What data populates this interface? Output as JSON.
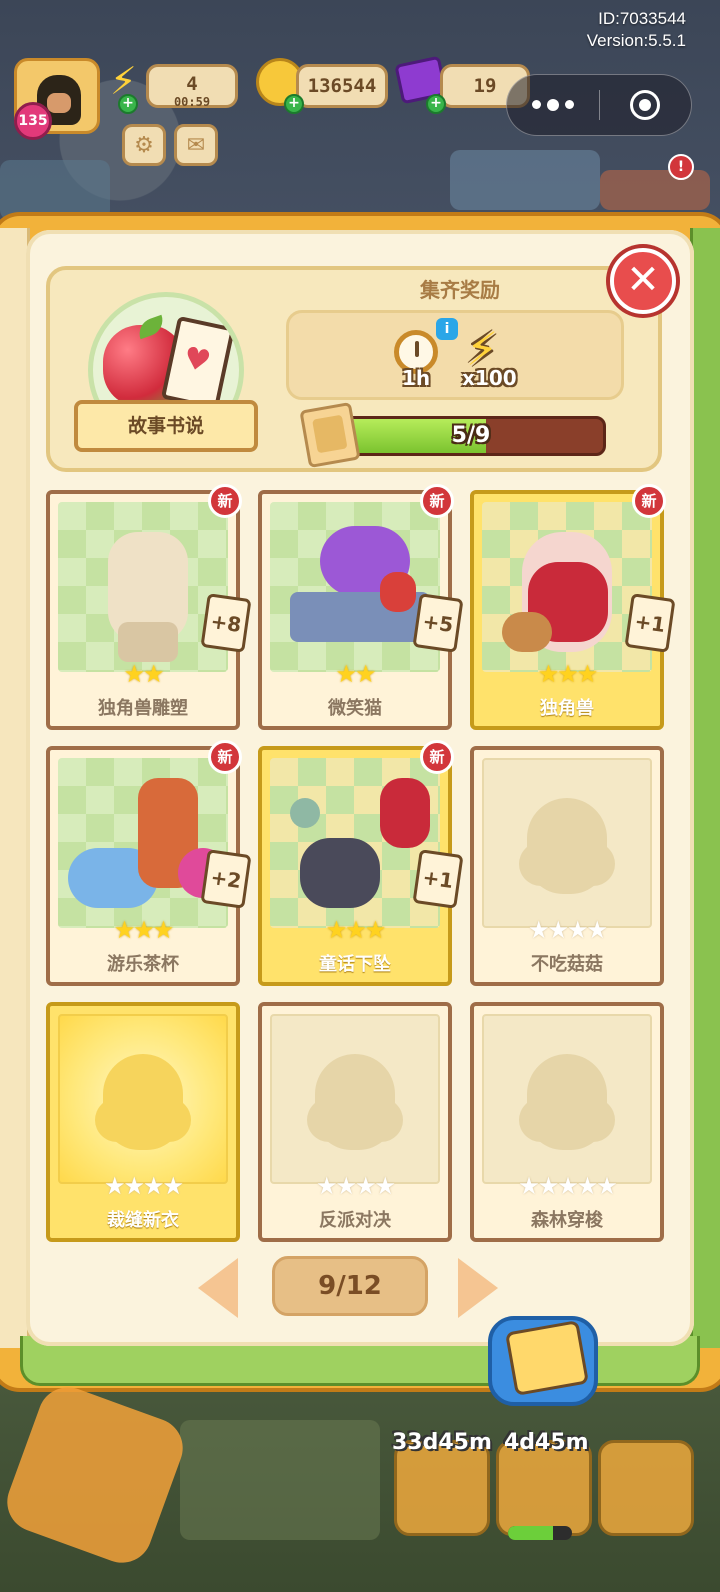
{
  "app": {
    "id_text": "ID:7033544",
    "version_text": "Version:5.5.1"
  },
  "hud": {
    "level": "135",
    "energy": {
      "value": "4",
      "timer": "00:59",
      "icon": "energy-bolt-icon"
    },
    "coins": {
      "value": "136544",
      "icon": "coin-icon"
    },
    "gems": {
      "value": "19",
      "icon": "gem-icon"
    },
    "buttons": [
      "settings-gear-icon",
      "mail-icon"
    ],
    "mini_program": {
      "more": "more-dots-icon",
      "close": "target-close-icon"
    }
  },
  "album": {
    "name": "故事书说",
    "reward_title": "集齐奖励",
    "rewards": [
      {
        "icon": "clock-icon",
        "value": "1h"
      },
      {
        "icon": "energy-bolt-icon",
        "value": "x100"
      }
    ],
    "progress": {
      "text": "5/9",
      "collected": 5,
      "total": 9
    },
    "close_icon": "close-icon"
  },
  "cards": [
    {
      "name": "独角兽雕塑",
      "stars_total": 2,
      "stars_filled": 2,
      "collected": true,
      "gold": false,
      "new_badge": "新",
      "duplicates": "+8"
    },
    {
      "name": "微笑猫",
      "stars_total": 2,
      "stars_filled": 2,
      "collected": true,
      "gold": false,
      "new_badge": "新",
      "duplicates": "+5"
    },
    {
      "name": "独角兽",
      "stars_total": 3,
      "stars_filled": 3,
      "collected": true,
      "gold": true,
      "new_badge": "新",
      "duplicates": "+1"
    },
    {
      "name": "游乐茶杯",
      "stars_total": 3,
      "stars_filled": 3,
      "collected": true,
      "gold": false,
      "new_badge": "新",
      "duplicates": "+2"
    },
    {
      "name": "童话下坠",
      "stars_total": 3,
      "stars_filled": 3,
      "collected": true,
      "gold": true,
      "new_badge": "新",
      "duplicates": "+1"
    },
    {
      "name": "不吃菇菇",
      "stars_total": 4,
      "stars_filled": 0,
      "collected": false,
      "gold": false
    },
    {
      "name": "裁缝新衣",
      "stars_total": 4,
      "stars_filled": 0,
      "collected": false,
      "gold": true
    },
    {
      "name": "反派对决",
      "stars_total": 4,
      "stars_filled": 0,
      "collected": false,
      "gold": false
    },
    {
      "name": "森林穿梭",
      "stars_total": 5,
      "stars_filled": 0,
      "collected": false,
      "gold": false
    }
  ],
  "pagination": {
    "text": "9/12",
    "prev_icon": "chevron-left-icon",
    "next_icon": "chevron-right-icon"
  },
  "album_button_icon": "card-pack-icon",
  "bottom_bar": {
    "timers": [
      "33d45m",
      "4d45m"
    ],
    "alert": "!"
  },
  "colors": {
    "book_frame": "#f2b23a",
    "page": "#fbf3dd",
    "progress_fill": "#7bc32f",
    "progress_track": "#8a3f2a",
    "new_badge": "#d2363b",
    "star": "#ffd21f"
  }
}
